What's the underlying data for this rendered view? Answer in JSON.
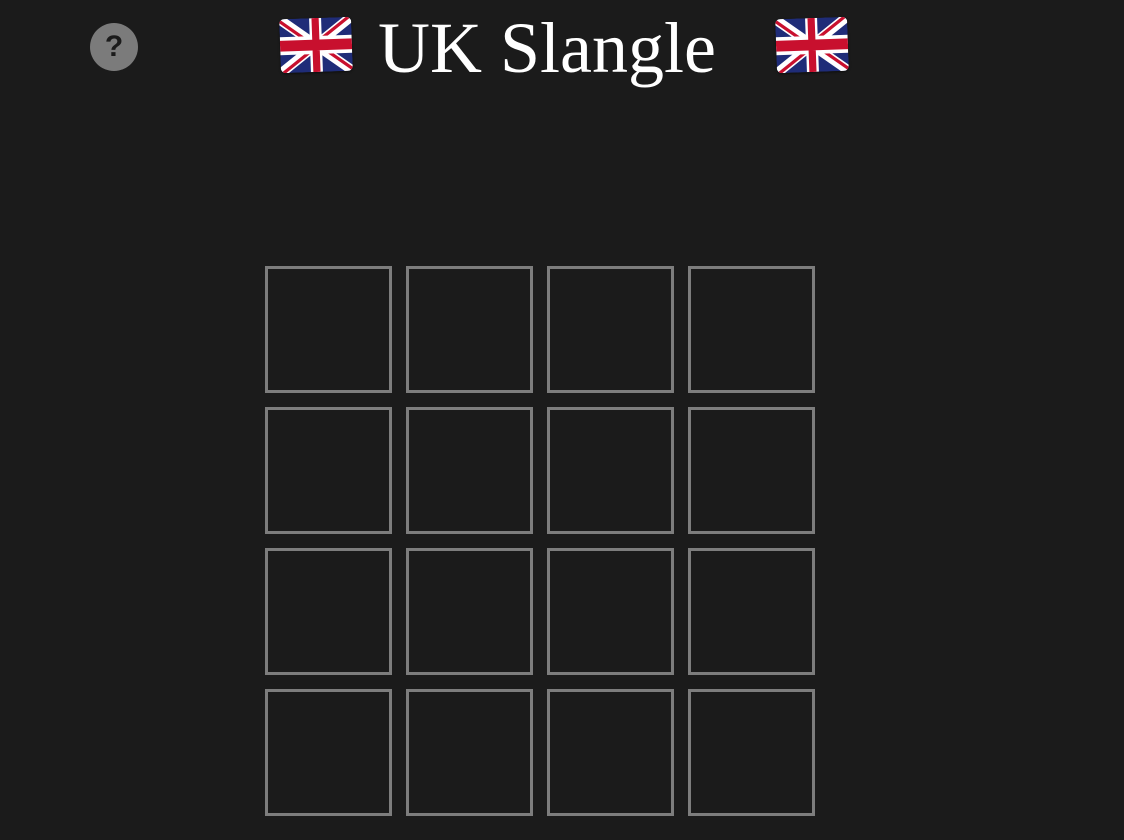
{
  "header": {
    "title": "UK Slangle",
    "flag_icon": "uk-flag-icon"
  },
  "help": {
    "label": "?",
    "icon": "question-mark-icon"
  },
  "board": {
    "rows": 4,
    "columns": 4,
    "tiles": [
      [
        "",
        "",
        "",
        ""
      ],
      [
        "",
        "",
        "",
        ""
      ],
      [
        "",
        "",
        "",
        ""
      ],
      [
        "",
        "",
        "",
        ""
      ]
    ]
  },
  "colors": {
    "background": "#1b1b1b",
    "tile_border": "#7d7d7d",
    "help_button": "#7b7b7b",
    "title_text": "#ffffff"
  }
}
